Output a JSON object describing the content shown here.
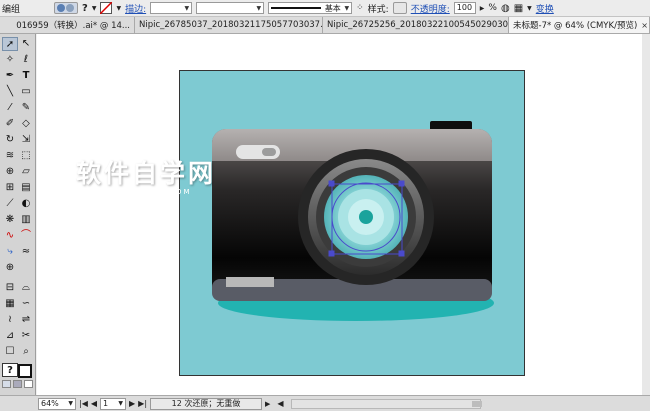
{
  "control_bar": {
    "selection_label": "编组",
    "question": "?",
    "stroke_label": "描边:",
    "stroke_style_label": "基本",
    "style_label": "样式:",
    "opacity_label": "不透明度:",
    "opacity_value": "100",
    "percent": "%",
    "transform_label": "变换"
  },
  "tabs": [
    {
      "label": "016959（转换）.ai* @ 14...",
      "active": false
    },
    {
      "label": "Nipic_26785037_20180321175057703037.ai*",
      "active": false
    },
    {
      "label": "Nipic_26725256_20180322100545029030.ai*",
      "active": false
    },
    {
      "label": "未标题-7* @ 64% (CMYK/预览)",
      "active": true
    }
  ],
  "toolbox": {
    "tools": [
      "selection-tool",
      "direct-selection-tool",
      "magic-wand-tool",
      "lasso-tool",
      "pen-tool",
      "type-tool",
      "line-tool",
      "rectangle-tool",
      "paintbrush-tool",
      "pencil-tool",
      "blob-brush-tool",
      "eraser-tool",
      "rotate-tool",
      "scale-tool",
      "warp-tool",
      "free-transform-tool",
      "shape-builder-tool",
      "perspective-tool",
      "mesh-tool",
      "gradient-tool",
      "eyedropper-tool",
      "blend-tool",
      "symbol-sprayer-tool",
      "column-graph-tool",
      "artboard-tool",
      "slice-tool",
      "hand-tool",
      "zoom-tool"
    ],
    "swap_label": "?"
  },
  "status_bar": {
    "zoom": "64%",
    "page": "1",
    "status_text": "12 次还原；无重做"
  },
  "watermark": {
    "title": "软件自学网",
    "url": "WWW.RJZXW.COM"
  },
  "colors": {
    "artboard_bg": "#7ecad2",
    "camera_top": "#a9a4a2",
    "camera_body_dark": "#111111",
    "lens_ring": "#6a6a6a",
    "lens_center": "#1aa39c",
    "shadow_teal": "#22b3b1",
    "selection_blue": "#4a4acc"
  }
}
